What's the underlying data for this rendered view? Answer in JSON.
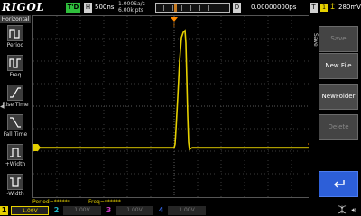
{
  "topbar": {
    "logo": "RIGOL",
    "run_state": "T'D",
    "horizontal_marker": "H",
    "timebase": "500ns",
    "sample_rate": "1.000Sa/s",
    "memory_depth": "6.00k pts",
    "trigger_offset_marker": "D",
    "trigger_offset": "0.00000000ps",
    "trigger_type_marker": "T",
    "trigger_source": "1",
    "trigger_edge": "rising",
    "trigger_level": "280mV"
  },
  "left_menu": {
    "title": "Horizontal",
    "items": [
      {
        "label": "Period",
        "icon": "period-icon"
      },
      {
        "label": "Freq",
        "icon": "frequency-icon"
      },
      {
        "label": "Rise Time",
        "icon": "rise-time-icon"
      },
      {
        "label": "Fall Time",
        "icon": "fall-time-icon"
      },
      {
        "label": "+Width",
        "icon": "positive-width-icon"
      },
      {
        "label": "-Width",
        "icon": "negative-width-icon"
      }
    ]
  },
  "right_menu": {
    "title": "Save",
    "buttons": [
      {
        "label": "Save",
        "enabled": false
      },
      {
        "label": "New File",
        "enabled": true
      },
      {
        "label": "NewFolder",
        "enabled": true
      },
      {
        "label": "Delete",
        "enabled": false
      },
      {
        "label": "",
        "icon": "return-icon",
        "enabled": true
      }
    ]
  },
  "measurements": {
    "period": "Period=******",
    "freq": "Freq=******"
  },
  "channels": [
    {
      "number": "1",
      "scale": "1.00V",
      "color": "#e5d000",
      "active": true
    },
    {
      "number": "2",
      "scale": "1.00V",
      "color": "#1fb6c8",
      "active": false
    },
    {
      "number": "3",
      "scale": "1.00V",
      "color": "#cc3cc8",
      "active": false
    },
    {
      "number": "4",
      "scale": "1.00V",
      "color": "#2f5fd8",
      "active": false
    }
  ],
  "trace": {
    "channel": "1",
    "color": "#e5d000",
    "baseline_level": "near zero",
    "pulse": "single positive pulse after trigger point"
  },
  "markers": {
    "channel_ground": "1",
    "trigger_level": "T"
  },
  "colors": {
    "background": "#000000",
    "grid": "#555555",
    "trace": "#e5d000",
    "run": "#2fbf3c",
    "trigger_marker": "#ff8a00"
  },
  "icons": {
    "usb": "usb-icon",
    "speaker": "speaker-icon"
  }
}
